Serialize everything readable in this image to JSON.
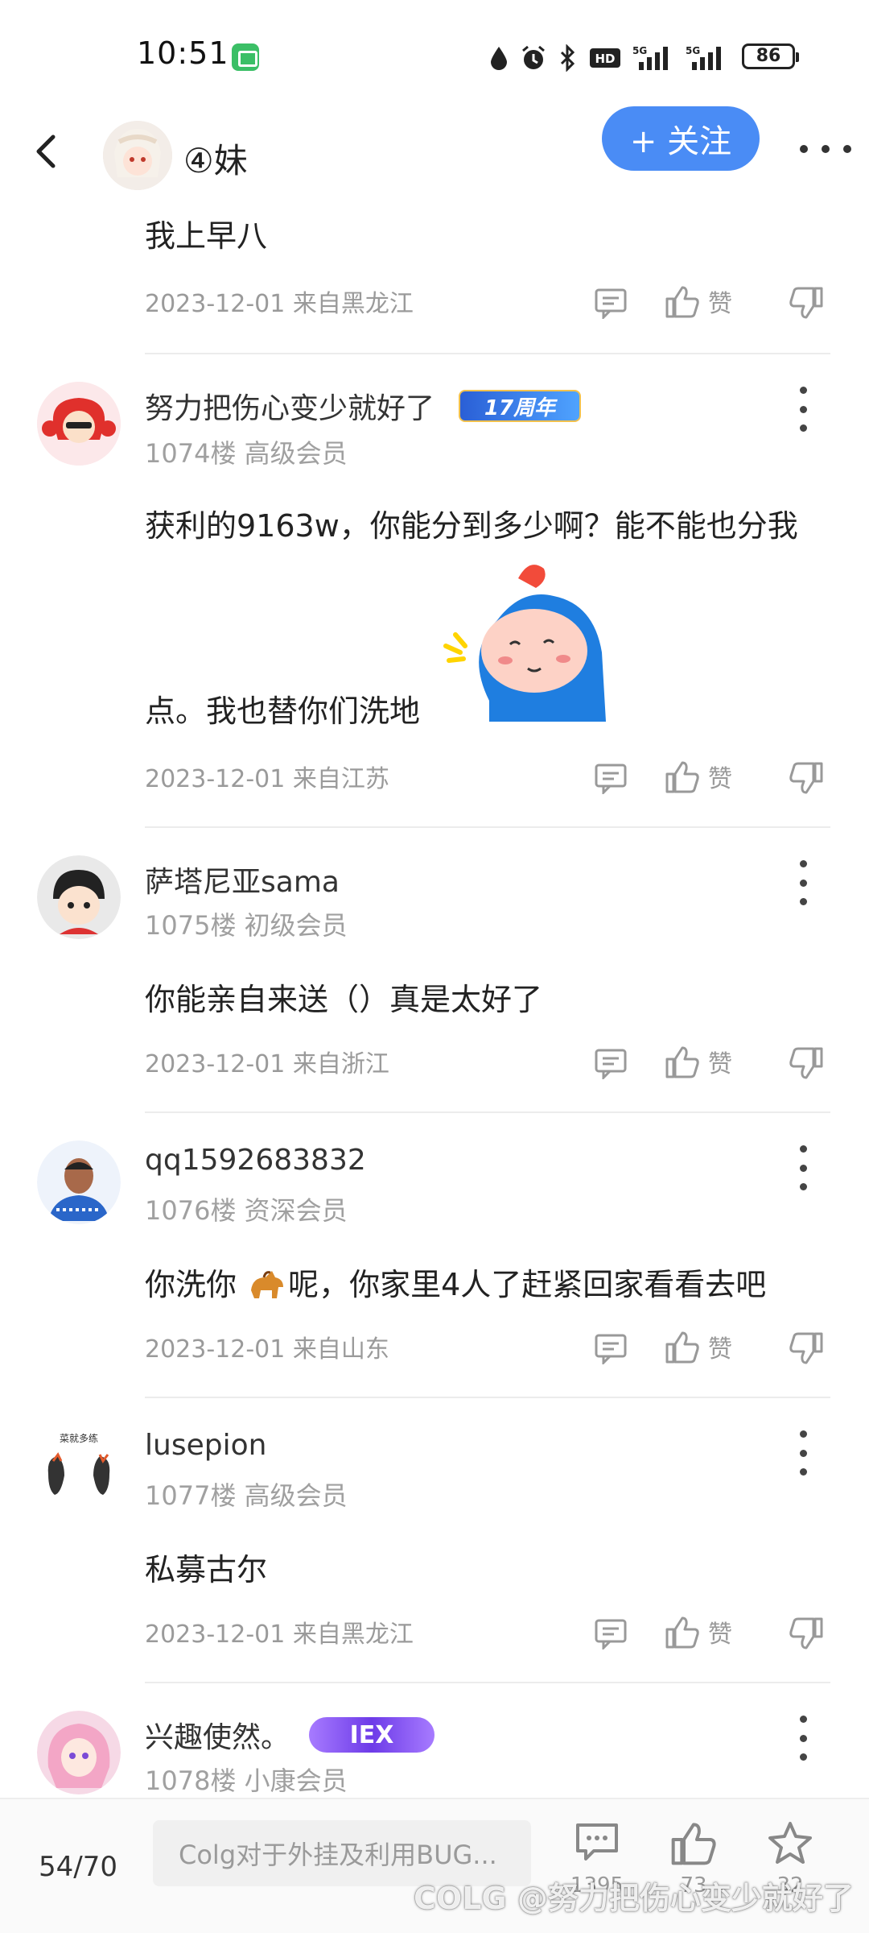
{
  "status_bar": {
    "time": "10:51",
    "battery": "86"
  },
  "header": {
    "title": "④妹",
    "follow_label": "+ 关注"
  },
  "first_post": {
    "text": "我上早八",
    "meta": "2023-12-01 来自黑龙江",
    "like_label": "赞"
  },
  "comments": [
    {
      "name": "努力把伤心变少就好了",
      "badge": "17周年",
      "floor": "1074楼 高级会员",
      "text_line1": "获利的9163w，你能分到多少啊？能不能也分我",
      "text_line2": "点。我也替你们洗地",
      "meta": "2023-12-01 来自江苏",
      "like_label": "赞"
    },
    {
      "name": "萨塔尼亚sama",
      "floor": "1075楼 初级会员",
      "text": "你能亲自来送（）真是太好了",
      "meta": "2023-12-01 来自浙江",
      "like_label": "赞"
    },
    {
      "name": "qq1592683832",
      "floor": "1076楼 资深会员",
      "text_before": "你洗你 ",
      "text_after": "呢，你家里4人了赶紧回家看看去吧",
      "meta": "2023-12-01 来自山东",
      "like_label": "赞"
    },
    {
      "name": "lusepion",
      "floor": "1077楼 高级会员",
      "avatar_text": "菜就多练",
      "text": "私募古尔",
      "meta": "2023-12-01 来自黑龙江",
      "like_label": "赞"
    },
    {
      "name": "兴趣使然。",
      "badge": "IEX",
      "floor": "1078楼 小康会员"
    }
  ],
  "bottom_bar": {
    "page": "54/70",
    "reply_placeholder": "Colg对于外挂及利用BUG...",
    "comment_count": "1395",
    "like_count": "73",
    "fav_count": "32"
  },
  "watermark": "COLG @努力把伤心变少就好了",
  "colors": {
    "accent": "#4a8cf5",
    "meta_gray": "#9a9a9a",
    "divider": "#ececec"
  },
  "icons": [
    "back-arrow-icon",
    "more-horizontal-icon",
    "comment-icon",
    "thumbs-up-icon",
    "thumbs-down-icon",
    "kebab-icon",
    "star-icon",
    "horse-emoji"
  ]
}
